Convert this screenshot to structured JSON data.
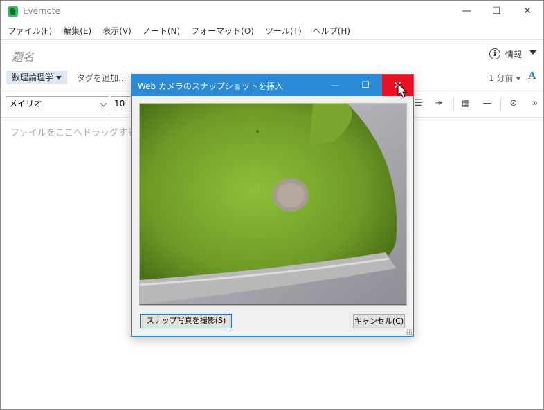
{
  "app": {
    "title": "Evernote",
    "controls": {
      "minimize": "—",
      "maximize": "☐",
      "close": "✕"
    }
  },
  "menu": [
    "ファイル(F)",
    "編集(E)",
    "表示(V)",
    "ノート(N)",
    "フォーマット(O)",
    "ツール(T)",
    "ヘルプ(H)"
  ],
  "note": {
    "title_placeholder": "題名",
    "info_label": "情報",
    "notebook": "数理論理学",
    "tag_add": "タグを追加...",
    "modified": "1 分前",
    "font_a": "A",
    "drop_hint": "ファイルをここへドラッグする"
  },
  "toolbar": {
    "font": "メイリオ",
    "size": "10",
    "icons": [
      "list-icon",
      "indent-icon",
      "table-icon",
      "horizontal-rule-icon",
      "attach-icon",
      "more-icon"
    ]
  },
  "dialog": {
    "title": "Web カメラのスナップショットを挿入",
    "snap_button": "スナップ写真を撮影(S)",
    "cancel_button": "キャンセル(C)",
    "close_color": "#e81123",
    "accent_color": "#2b8ad6"
  }
}
